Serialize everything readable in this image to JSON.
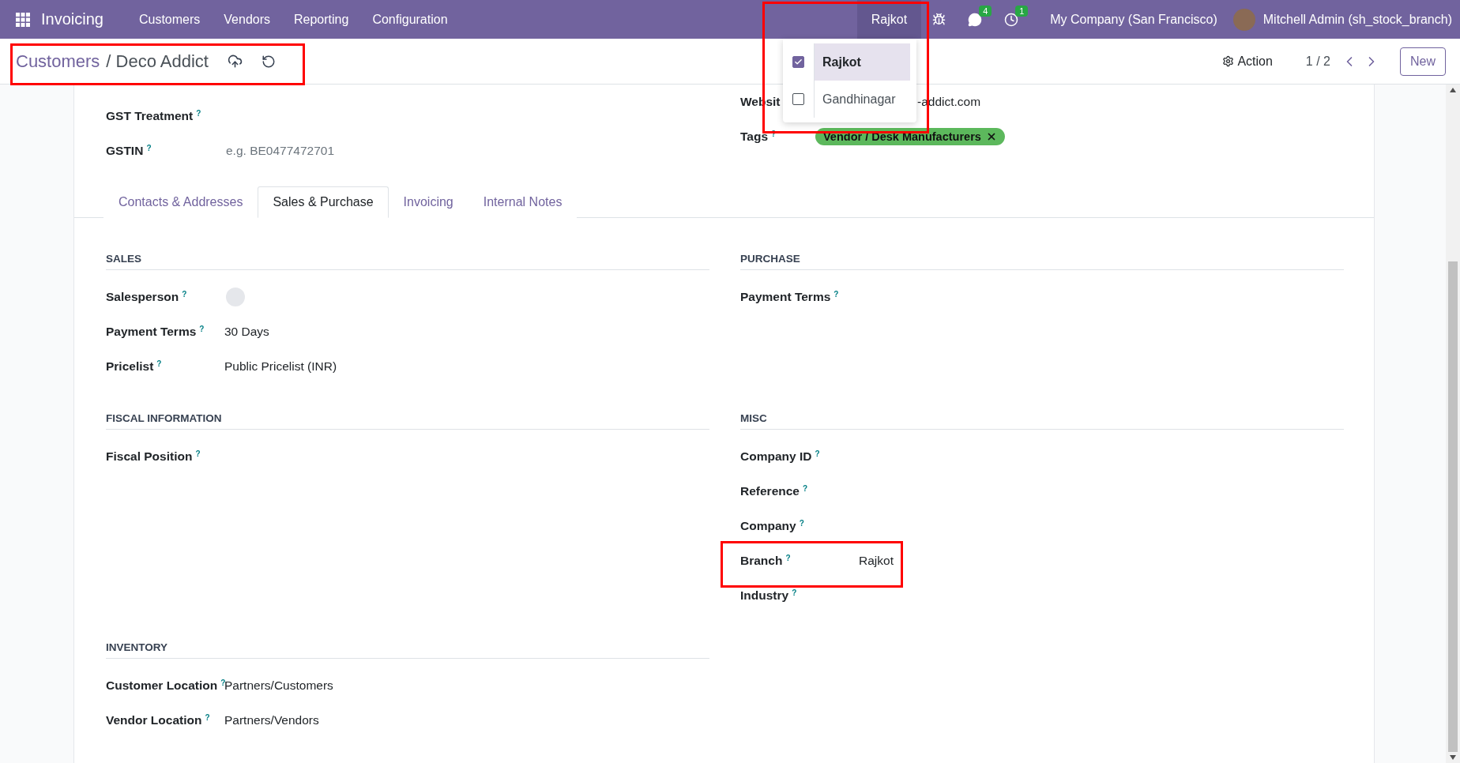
{
  "navbar": {
    "app_name": "Invoicing",
    "menu": [
      "Customers",
      "Vendors",
      "Reporting",
      "Configuration"
    ],
    "branch_switcher": "Rajkot",
    "messages_badge": "4",
    "activities_badge": "1",
    "company": "My Company (San Francisco)",
    "user": "Mitchell Admin (sh_stock_branch)"
  },
  "branch_dropdown": [
    {
      "label": "Rajkot",
      "checked": true,
      "selected": true
    },
    {
      "label": "Gandhinagar",
      "checked": false,
      "selected": false
    }
  ],
  "breadcrumb": {
    "parent": "Customers",
    "separator": "/",
    "current": "Deco Addict"
  },
  "control_panel": {
    "action": "Action",
    "pager": "1 / 2",
    "new_button": "New"
  },
  "top_fields": {
    "left": [
      {
        "kind": "text",
        "label": "GST Treatment",
        "help": "?"
      },
      {
        "kind": "input",
        "label": "GSTIN",
        "help": "?",
        "placeholder": "e.g. BE0477472701"
      }
    ],
    "right": [
      {
        "kind": "text",
        "label": "Websit",
        "value": "-addict.com"
      },
      {
        "kind": "tags",
        "label": "Tags",
        "help": "?",
        "tags": [
          "Vendor / Desk Manufacturers"
        ]
      }
    ]
  },
  "tabs": [
    {
      "label": "Contacts & Addresses",
      "selected": false
    },
    {
      "label": "Sales & Purchase",
      "selected": true
    },
    {
      "label": "Invoicing",
      "selected": false
    },
    {
      "label": "Internal Notes",
      "selected": false
    }
  ],
  "sections": [
    [
      {
        "title": "SALES",
        "fields": [
          {
            "kind": "avatar",
            "label": "Salesperson",
            "help": "?"
          },
          {
            "kind": "text",
            "label": "Payment Terms",
            "help": "?",
            "value": "30 Days"
          },
          {
            "kind": "text",
            "label": "Pricelist",
            "help": "?",
            "value": "Public Pricelist (INR)"
          }
        ]
      },
      {
        "title": "PURCHASE",
        "fields": [
          {
            "kind": "text",
            "label": "Payment Terms",
            "help": "?"
          }
        ]
      }
    ],
    [
      {
        "title": "FISCAL INFORMATION",
        "fields": [
          {
            "kind": "text",
            "label": "Fiscal Position",
            "help": "?"
          }
        ]
      },
      {
        "title": "MISC",
        "fields": [
          {
            "kind": "text",
            "label": "Company ID",
            "help": "?"
          },
          {
            "kind": "text",
            "label": "Reference",
            "help": "?"
          },
          {
            "kind": "text",
            "label": "Company",
            "help": "?"
          },
          {
            "kind": "text",
            "label": "Branch",
            "help": "?",
            "value": "Rajkot"
          },
          {
            "kind": "text",
            "label": "Industry",
            "help": "?"
          }
        ]
      }
    ],
    [
      {
        "title": "INVENTORY",
        "fields": [
          {
            "kind": "text",
            "label": "Customer Location",
            "help": "?",
            "value": "Partners/Customers"
          },
          {
            "kind": "text",
            "label": "Vendor Location",
            "help": "?",
            "value": "Partners/Vendors"
          }
        ]
      }
    ]
  ]
}
